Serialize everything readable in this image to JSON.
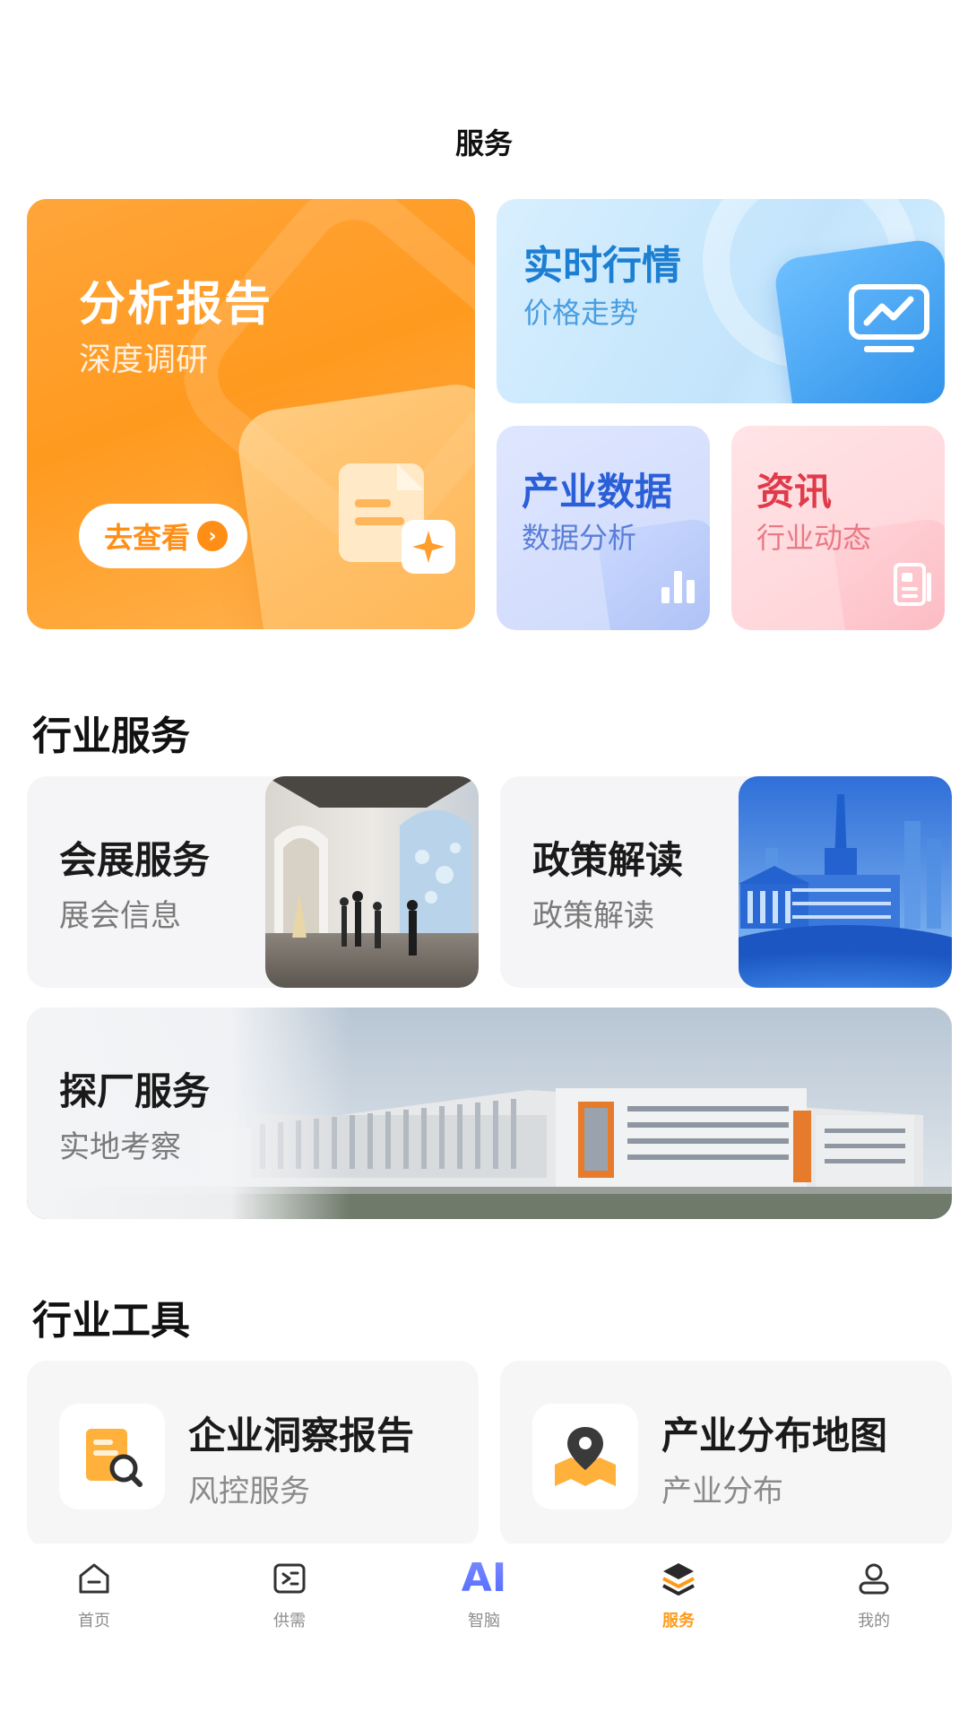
{
  "header": {
    "title": "服务"
  },
  "feature_cards": {
    "report": {
      "title": "分析报告",
      "subtitle": "深度调研",
      "button_label": "去查看"
    },
    "market": {
      "title": "实时行情",
      "subtitle": "价格走势"
    },
    "industry_data": {
      "title": "产业数据",
      "subtitle": "数据分析"
    },
    "news": {
      "title": "资讯",
      "subtitle": "行业动态"
    }
  },
  "industry_services": {
    "section_title": "行业服务",
    "expo": {
      "title": "会展服务",
      "subtitle": "展会信息"
    },
    "policy": {
      "title": "政策解读",
      "subtitle": "政策解读"
    },
    "factory": {
      "title": "探厂服务",
      "subtitle": "实地考察"
    }
  },
  "industry_tools": {
    "section_title": "行业工具",
    "insight": {
      "title": "企业洞察报告",
      "subtitle": "风控服务"
    },
    "map": {
      "title": "产业分布地图",
      "subtitle": "产业分布"
    }
  },
  "bottom_nav": {
    "home": "首页",
    "supply": "供需",
    "ai_glyph": "AI",
    "ai": "智脑",
    "service": "服务",
    "mine": "我的"
  },
  "colors": {
    "accent": "#ff9a18",
    "report_bg": "#ff9e2c",
    "market_bg": "#c9e8fc",
    "industry_bg": "#d4deff",
    "news_bg": "#ffd8dc"
  }
}
